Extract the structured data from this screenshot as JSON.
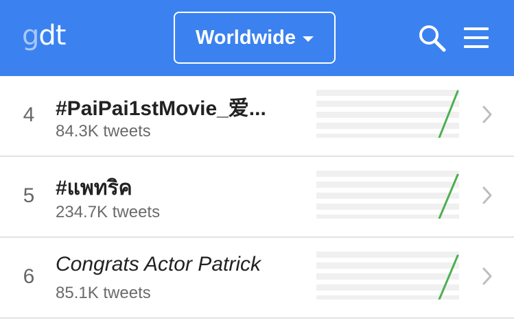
{
  "header": {
    "logo_prefix": "g",
    "logo_suffix": "dt",
    "region_label": "Worldwide",
    "brand_color": "#3b82f0"
  },
  "icons": {
    "search": "search-icon",
    "menu": "hamburger-menu-icon",
    "row_arrow": "chevron-right-icon",
    "dropdown": "caret-down-icon"
  },
  "trends": [
    {
      "rank": "4",
      "name": "#PaiPai1stMovie_爱...",
      "count": "84.3K tweets",
      "italic": false
    },
    {
      "rank": "5",
      "name": "#แพทริค",
      "count": "234.7K tweets",
      "italic": false
    },
    {
      "rank": "6",
      "name": "Congrats Actor Patrick",
      "count": "85.1K tweets",
      "italic": true
    }
  ],
  "sparkline_color": "#4caf50"
}
